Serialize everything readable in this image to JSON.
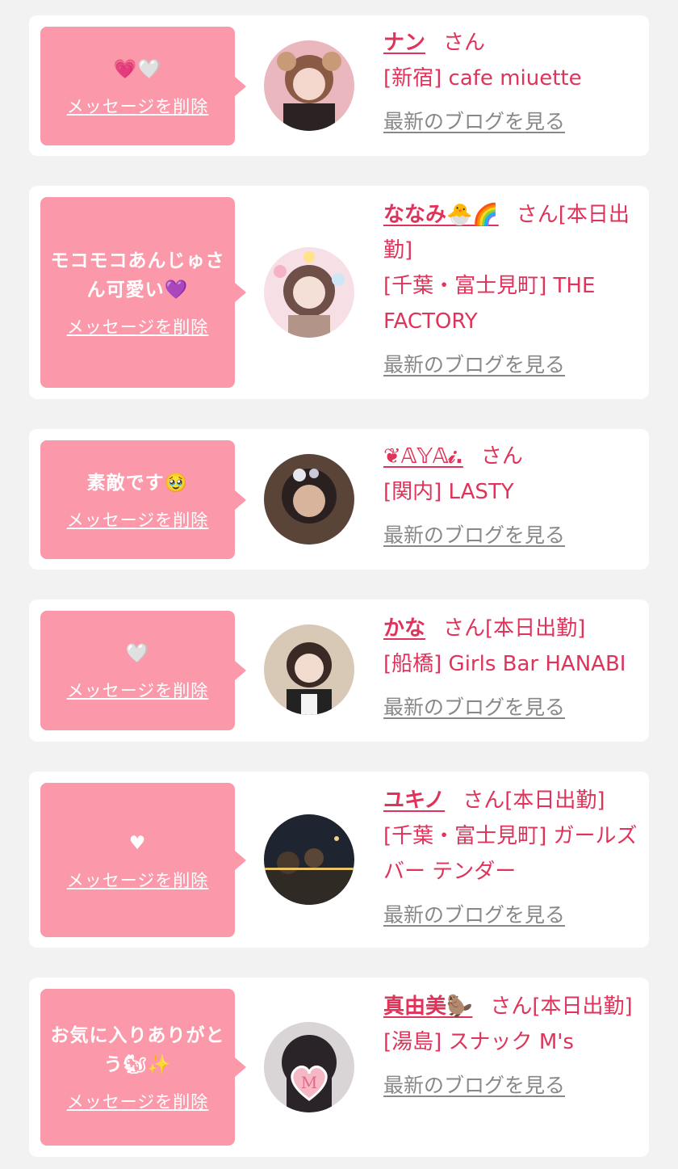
{
  "delete_label": "メッセージを削除",
  "blog_label": "最新のブログを見る",
  "san_label": "さん",
  "colors": {
    "accent": "#e0335a",
    "bubble": "#fb99aa",
    "link_gray": "#888888",
    "background": "#f2f2f2"
  },
  "cards": [
    {
      "message": "💗🤍",
      "name": "ナン",
      "suffix": "さん",
      "shop": "[新宿] cafe miuette",
      "avatar": "woman-with-bear-ears-photo"
    },
    {
      "message": "モコモコあんじゅさん可愛い💜",
      "name": "ななみ🐣🌈",
      "suffix": "さん[本日出勤]",
      "shop": "[千葉・富士見町] THE FACTORY",
      "avatar": "woman-with-sticker-frame-photo"
    },
    {
      "message": "素敵です🥹",
      "name": "❦𝔸𝕐𝔸𝒾.",
      "suffix": "さん",
      "shop": "[関内] LASTY",
      "avatar": "woman-with-hair-bow-photo"
    },
    {
      "message": "🤍",
      "name": "かな",
      "suffix": "さん[本日出勤]",
      "shop": "[船橋] Girls Bar HANABI",
      "avatar": "woman-smiling-photo"
    },
    {
      "message": "♥",
      "name": "ユキノ",
      "suffix": "さん[本日出勤]",
      "shop": "[千葉・富士見町] ガールズバー テンダー",
      "avatar": "night-scene-photo"
    },
    {
      "message": "お気に入りありがとう🐿✨",
      "name": "真由美🦫",
      "suffix": "さん[本日出勤]",
      "shop": "[湯島] スナック M's",
      "avatar": "woman-with-heart-m-sticker-photo",
      "sticker_text": "M"
    }
  ]
}
